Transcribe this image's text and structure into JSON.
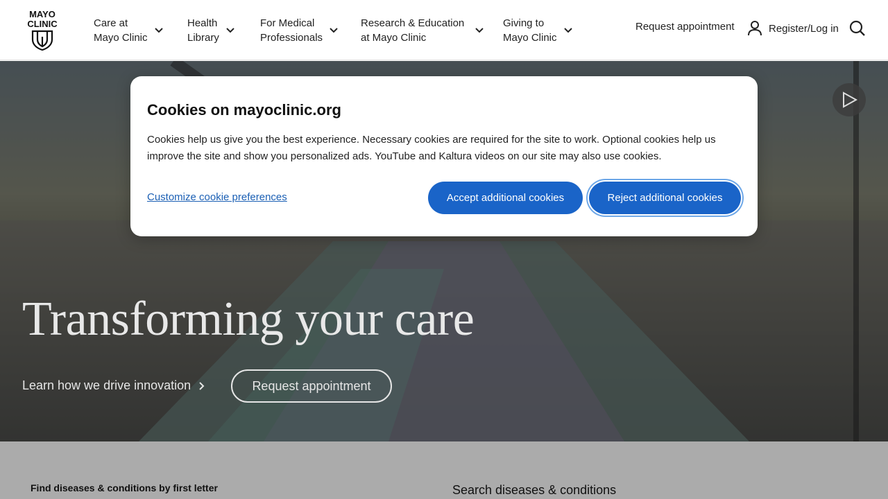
{
  "header": {
    "logo_line1": "MAYO",
    "logo_line2": "CLINIC",
    "nav": [
      {
        "label": "Care at\nMayo Clinic"
      },
      {
        "label": "Health\nLibrary"
      },
      {
        "label": "For Medical\nProfessionals"
      },
      {
        "label": "Research & Education\nat Mayo Clinic"
      },
      {
        "label": "Giving to\nMayo Clinic"
      }
    ],
    "request_appointment": "Request appointment",
    "register_login": "Register/Log in",
    "icons": {
      "chevron": "chevron-down-icon",
      "user": "user-icon",
      "search": "search-icon"
    }
  },
  "hero": {
    "title": "Transforming your care",
    "learn_link": "Learn how we drive innovation",
    "request_button": "Request appointment",
    "play_icon": "play-icon"
  },
  "cookie_dialog": {
    "title": "Cookies on mayoclinic.org",
    "body": "Cookies help us give you the best experience. Necessary cookies are required for the site to work. Optional cookies help us improve the site and show you personalized ads. YouTube and Kaltura videos on our site may also use cookies.",
    "customize_link": "Customize cookie preferences",
    "accept_button": "Accept additional cookies",
    "reject_button": "Reject additional cookies"
  },
  "below_fold": {
    "find_by_letter": "Find diseases & conditions by first letter",
    "search_heading": "Search diseases & conditions"
  },
  "colors": {
    "accent_blue": "#1a64c8",
    "link_blue": "#1a5fb4"
  }
}
